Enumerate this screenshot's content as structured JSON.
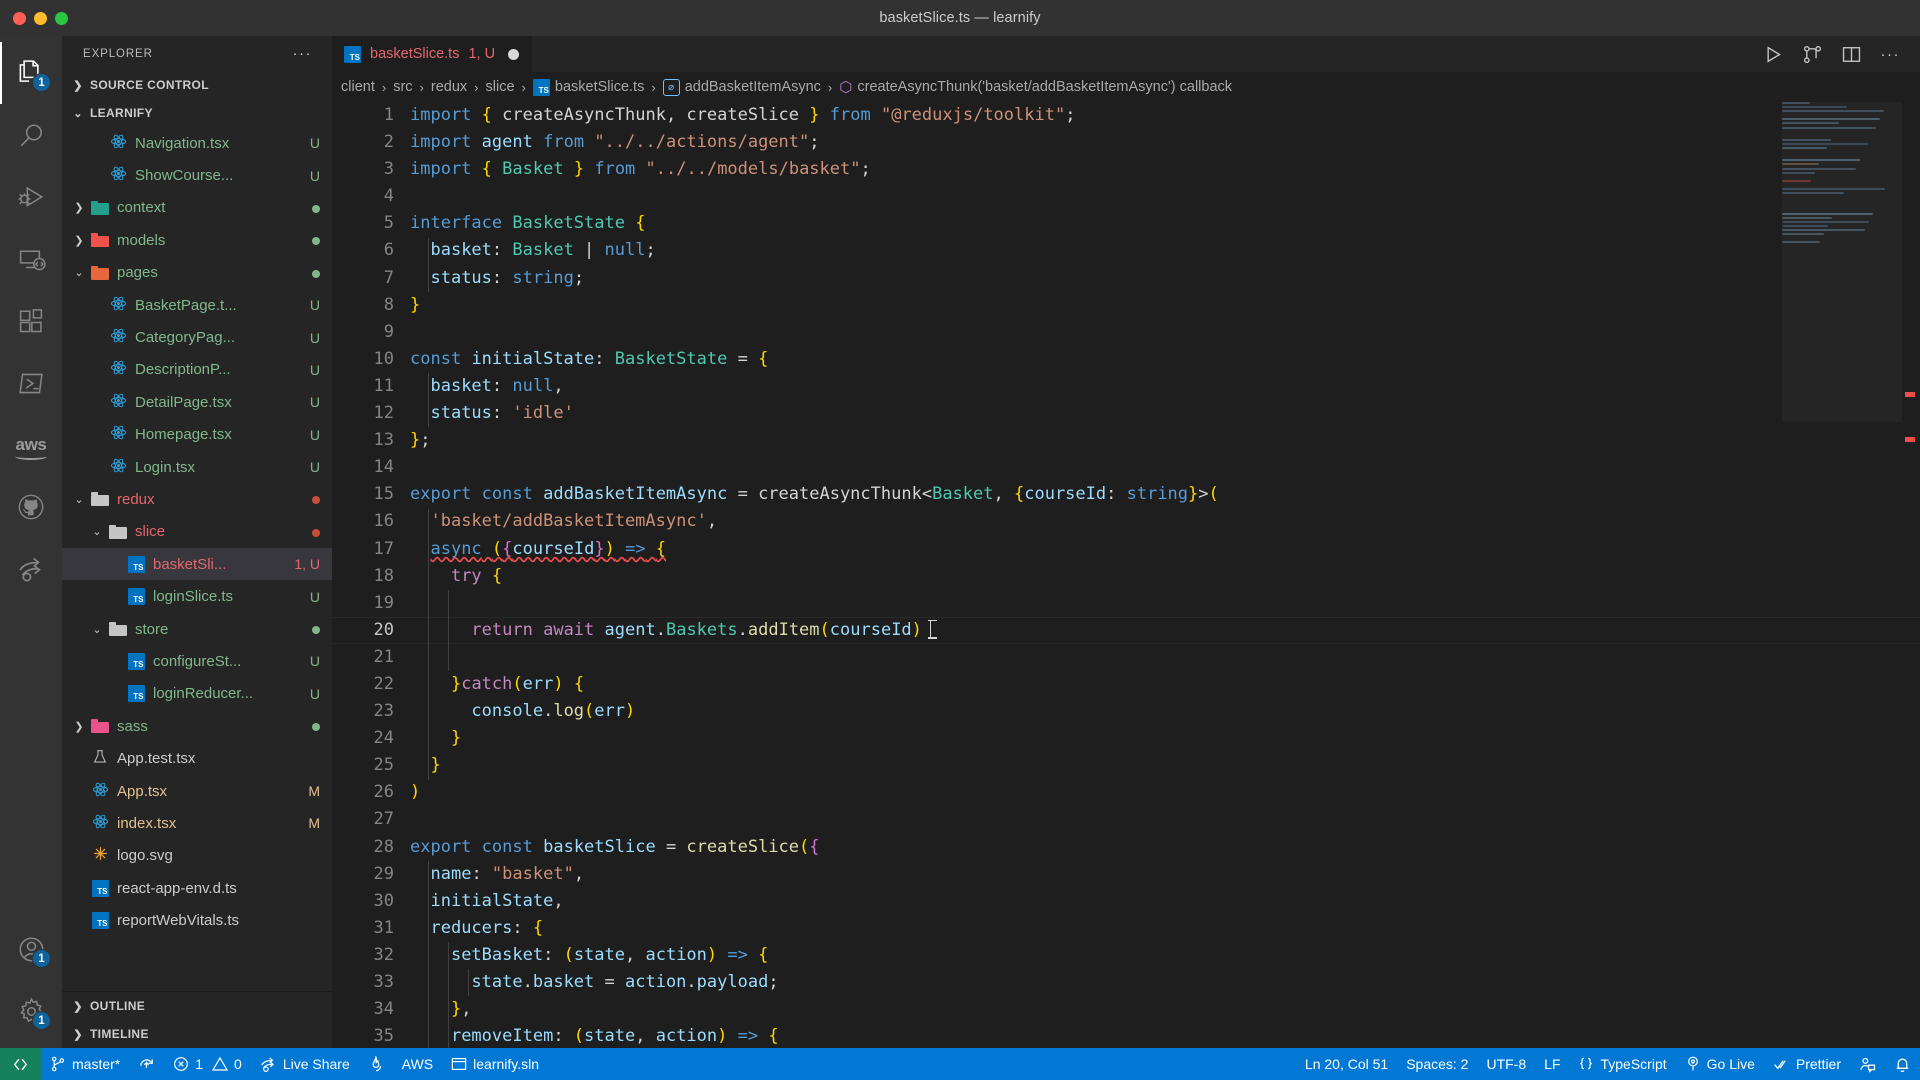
{
  "window": {
    "title": "basketSlice.ts — learnify"
  },
  "activity_bar": {
    "items": [
      {
        "name": "explorer",
        "icon": "files-icon",
        "badge": "1",
        "active": true
      },
      {
        "name": "search",
        "icon": "search-icon",
        "badge": null,
        "active": false
      },
      {
        "name": "run-and-debug",
        "icon": "run-debug-icon",
        "badge": null,
        "active": false
      },
      {
        "name": "remote-explorer",
        "icon": "remote-icon",
        "badge": null,
        "active": false
      },
      {
        "name": "extensions",
        "icon": "extensions-icon",
        "badge": null,
        "active": false
      },
      {
        "name": "powershell",
        "icon": "terminal-icon",
        "badge": null,
        "active": false
      },
      {
        "name": "aws-toolkit",
        "icon": "aws-icon",
        "label": "aws",
        "badge": null,
        "active": false
      },
      {
        "name": "github",
        "icon": "github-icon",
        "badge": null,
        "active": false
      },
      {
        "name": "live-share",
        "icon": "live-share-icon",
        "badge": null,
        "active": false
      }
    ],
    "bottom_items": [
      {
        "name": "accounts",
        "icon": "account-icon",
        "badge": "1"
      },
      {
        "name": "manage-settings",
        "icon": "gear-icon",
        "badge": "1"
      }
    ]
  },
  "sidebar": {
    "title": "EXPLORER",
    "more_actions": "···",
    "sections": [
      {
        "label": "SOURCE CONTROL",
        "expanded": false
      },
      {
        "label": "LEARNIFY",
        "expanded": true
      },
      {
        "label": "OUTLINE",
        "expanded": false
      },
      {
        "label": "TIMELINE",
        "expanded": false
      }
    ],
    "tree": [
      {
        "name": "Navigation.tsx",
        "icon": "react-icon",
        "indent": 3,
        "status": "U",
        "color": "green",
        "arrow": ""
      },
      {
        "name": "ShowCourse...",
        "icon": "react-icon",
        "indent": 3,
        "status": "U",
        "color": "green",
        "arrow": ""
      },
      {
        "name": "context",
        "icon": "folder-teal",
        "indent": 2,
        "status": "dot-green",
        "color": "green",
        "arrow": "collapsed"
      },
      {
        "name": "models",
        "icon": "folder-red",
        "indent": 2,
        "status": "dot-green",
        "color": "green",
        "arrow": "collapsed"
      },
      {
        "name": "pages",
        "icon": "folder-orange",
        "indent": 2,
        "status": "dot-green",
        "color": "green",
        "arrow": "expanded"
      },
      {
        "name": "BasketPage.t...",
        "icon": "react-icon",
        "indent": 3,
        "status": "U",
        "color": "green",
        "arrow": ""
      },
      {
        "name": "CategoryPag...",
        "icon": "react-icon",
        "indent": 3,
        "status": "U",
        "color": "green",
        "arrow": ""
      },
      {
        "name": "DescriptionP...",
        "icon": "react-icon",
        "indent": 3,
        "status": "U",
        "color": "green",
        "arrow": ""
      },
      {
        "name": "DetailPage.tsx",
        "icon": "react-icon",
        "indent": 3,
        "status": "U",
        "color": "green",
        "arrow": ""
      },
      {
        "name": "Homepage.tsx",
        "icon": "react-icon",
        "indent": 3,
        "status": "U",
        "color": "green",
        "arrow": ""
      },
      {
        "name": "Login.tsx",
        "icon": "react-icon",
        "indent": 3,
        "status": "U",
        "color": "green",
        "arrow": ""
      },
      {
        "name": "redux",
        "icon": "folder-plain",
        "indent": 2,
        "status": "dot-red",
        "color": "red",
        "arrow": "expanded"
      },
      {
        "name": "slice",
        "icon": "folder-plain",
        "indent": 3,
        "status": "dot-red",
        "color": "red",
        "arrow": "expanded"
      },
      {
        "name": "basketSli...",
        "icon": "ts-icon",
        "indent": 4,
        "status": "1, U",
        "color": "red",
        "arrow": "",
        "selected": true
      },
      {
        "name": "loginSlice.ts",
        "icon": "ts-icon",
        "indent": 4,
        "status": "U",
        "color": "green",
        "arrow": ""
      },
      {
        "name": "store",
        "icon": "folder-plain",
        "indent": 3,
        "status": "dot-green",
        "color": "green",
        "arrow": "expanded"
      },
      {
        "name": "configureSt...",
        "icon": "ts-icon",
        "indent": 4,
        "status": "U",
        "color": "green",
        "arrow": ""
      },
      {
        "name": "loginReducer...",
        "icon": "ts-icon",
        "indent": 4,
        "status": "U",
        "color": "green",
        "arrow": ""
      },
      {
        "name": "sass",
        "icon": "folder-pink",
        "indent": 2,
        "status": "dot-green",
        "color": "green",
        "arrow": "collapsed"
      },
      {
        "name": "App.test.tsx",
        "icon": "test-icon",
        "indent": 2,
        "status": "",
        "color": "plain",
        "arrow": ""
      },
      {
        "name": "App.tsx",
        "icon": "react-icon",
        "indent": 2,
        "status": "M",
        "color": "mod",
        "arrow": ""
      },
      {
        "name": "index.tsx",
        "icon": "react-icon",
        "indent": 2,
        "status": "M",
        "color": "mod",
        "arrow": ""
      },
      {
        "name": "logo.svg",
        "icon": "svg-icon",
        "indent": 2,
        "status": "",
        "color": "plain",
        "arrow": ""
      },
      {
        "name": "react-app-env.d.ts",
        "icon": "ts-icon",
        "indent": 2,
        "status": "",
        "color": "plain",
        "arrow": ""
      },
      {
        "name": "reportWebVitals.ts",
        "icon": "ts-icon",
        "indent": 2,
        "status": "",
        "color": "plain",
        "arrow": ""
      }
    ]
  },
  "editor": {
    "tab": {
      "filename": "basketSlice.ts",
      "counter": "1, U",
      "icon": "ts-icon",
      "dirty": true
    },
    "tab_actions": [
      "run-icon",
      "split-compare-icon",
      "split-editor-icon",
      "more-actions-icon"
    ],
    "breadcrumbs": [
      {
        "label": "client",
        "icon": null
      },
      {
        "label": "src",
        "icon": null
      },
      {
        "label": "redux",
        "icon": null
      },
      {
        "label": "slice",
        "icon": null
      },
      {
        "label": "basketSlice.ts",
        "icon": "ts-icon"
      },
      {
        "label": "addBasketItemAsync",
        "icon": "symbol-variable-icon"
      },
      {
        "label": "createAsyncThunk('basket/addBasketItemAsync') callback",
        "icon": "symbol-object-icon"
      }
    ],
    "separator": "›",
    "first_line": 1,
    "lines": [
      {
        "n": 1,
        "text": "import { createAsyncThunk, createSlice } from \"@reduxjs/toolkit\";"
      },
      {
        "n": 2,
        "text": "import agent from \"../../actions/agent\";"
      },
      {
        "n": 3,
        "text": "import { Basket } from \"../../models/basket\";"
      },
      {
        "n": 4,
        "text": ""
      },
      {
        "n": 5,
        "text": "interface BasketState {"
      },
      {
        "n": 6,
        "text": "  basket: Basket | null;"
      },
      {
        "n": 7,
        "text": "  status: string;"
      },
      {
        "n": 8,
        "text": "}"
      },
      {
        "n": 9,
        "text": ""
      },
      {
        "n": 10,
        "text": "const initialState: BasketState = {"
      },
      {
        "n": 11,
        "text": "  basket: null,"
      },
      {
        "n": 12,
        "text": "  status: 'idle'"
      },
      {
        "n": 13,
        "text": "};"
      },
      {
        "n": 14,
        "text": ""
      },
      {
        "n": 15,
        "text": "export const addBasketItemAsync = createAsyncThunk<Basket, {courseId: string}>("
      },
      {
        "n": 16,
        "text": "  'basket/addBasketItemAsync',"
      },
      {
        "n": 17,
        "text": "  async ({courseId}) => {"
      },
      {
        "n": 18,
        "text": "    try {"
      },
      {
        "n": 19,
        "text": ""
      },
      {
        "n": 20,
        "text": "      return await agent.Baskets.addItem(courseId)",
        "highlighted": true
      },
      {
        "n": 21,
        "text": ""
      },
      {
        "n": 22,
        "text": "    }catch(err) {"
      },
      {
        "n": 23,
        "text": "      console.log(err)"
      },
      {
        "n": 24,
        "text": "    }"
      },
      {
        "n": 25,
        "text": "  }"
      },
      {
        "n": 26,
        "text": ")"
      },
      {
        "n": 27,
        "text": ""
      },
      {
        "n": 28,
        "text": "export const basketSlice = createSlice({"
      },
      {
        "n": 29,
        "text": "  name: \"basket\","
      },
      {
        "n": 30,
        "text": "  initialState,"
      },
      {
        "n": 31,
        "text": "  reducers: {"
      },
      {
        "n": 32,
        "text": "    setBasket: (state, action) => {"
      },
      {
        "n": 33,
        "text": "      state.basket = action.payload;"
      },
      {
        "n": 34,
        "text": "    },"
      },
      {
        "n": 35,
        "text": "    removeItem: (state, action) => {"
      }
    ]
  },
  "status_bar": {
    "left": [
      {
        "name": "remote-window",
        "label": "",
        "icon": "remote-icon"
      },
      {
        "name": "git-branch",
        "label": "master*",
        "icon": "source-control-icon"
      },
      {
        "name": "sync-changes",
        "label": "",
        "icon": "sync-icon"
      },
      {
        "name": "problems",
        "label": "1",
        "icon": "error-icon",
        "label2": "0",
        "icon2": "warning-icon"
      },
      {
        "name": "live-share",
        "label": "Live Share",
        "icon": "live-share-icon"
      },
      {
        "name": "firebase",
        "label": "",
        "icon": "flame-icon"
      },
      {
        "name": "aws",
        "label": "AWS",
        "icon": null
      },
      {
        "name": "solution",
        "label": "learnify.sln",
        "icon": "window-icon"
      }
    ],
    "right": [
      {
        "name": "cursor-position",
        "label": "Ln 20, Col 51"
      },
      {
        "name": "indentation",
        "label": "Spaces: 2"
      },
      {
        "name": "encoding",
        "label": "UTF-8"
      },
      {
        "name": "eol",
        "label": "LF"
      },
      {
        "name": "language-mode",
        "label": "TypeScript",
        "icon": "braces-icon"
      },
      {
        "name": "go-live",
        "label": "Go Live",
        "icon": "broadcast-icon"
      },
      {
        "name": "prettier",
        "label": "Prettier",
        "icon": "check-check-icon"
      },
      {
        "name": "feedback",
        "label": "",
        "icon": "feedback-icon"
      },
      {
        "name": "notifications",
        "label": "",
        "icon": "bell-icon"
      }
    ]
  },
  "colors": {
    "accent": "#0078d4",
    "remote_green": "#16825d",
    "editor_bg": "#1e1e1e",
    "sidebar_bg": "#252526",
    "activity_bg": "#333333",
    "untracked": "#81b88b",
    "modified": "#e2c08d",
    "conflict": "#e4676b"
  }
}
